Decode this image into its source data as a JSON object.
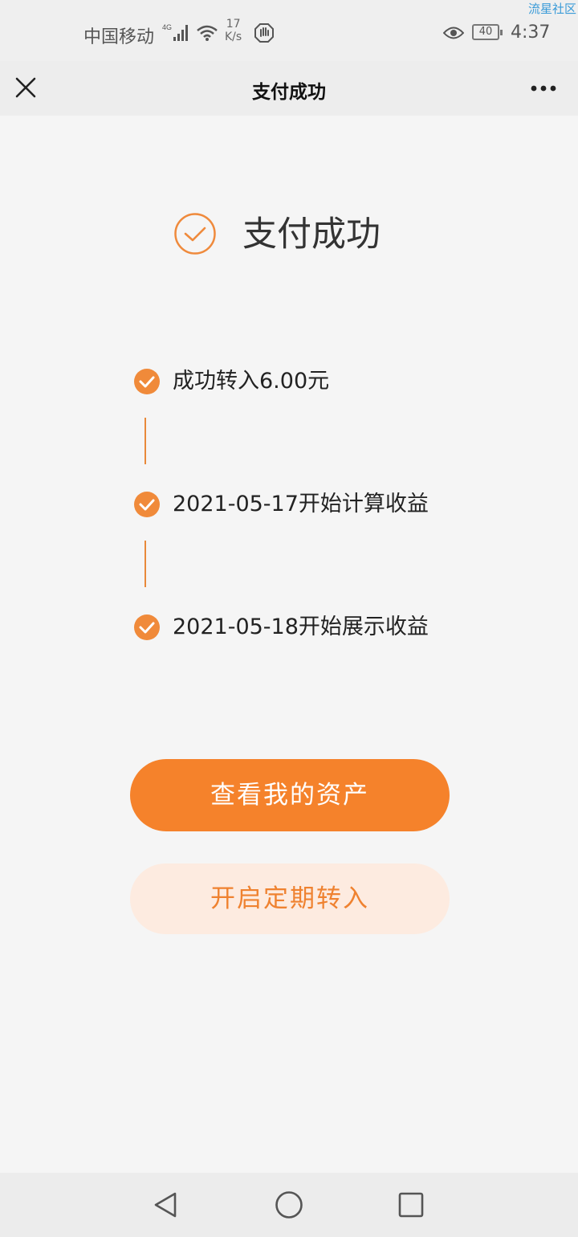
{
  "status_bar": {
    "carrier": "中国移动",
    "network": "4G",
    "speed_value": "17",
    "speed_unit": "K/s",
    "battery": "40",
    "time": "4:37",
    "watermark": "流星社区"
  },
  "nav": {
    "title": "支付成功",
    "close_icon": "close-icon",
    "more_icon": "more-icon"
  },
  "hero": {
    "title": "支付成功",
    "icon": "check-circle-icon"
  },
  "steps": [
    {
      "label": "成功转入6.00元"
    },
    {
      "label": "2021-05-17开始计算收益"
    },
    {
      "label": "2021-05-18开始展示收益"
    }
  ],
  "buttons": {
    "primary": "查看我的资产",
    "secondary": "开启定期转入"
  },
  "colors": {
    "accent": "#f5822b",
    "accent_light": "#fdebe0",
    "background": "#f5f5f5"
  }
}
